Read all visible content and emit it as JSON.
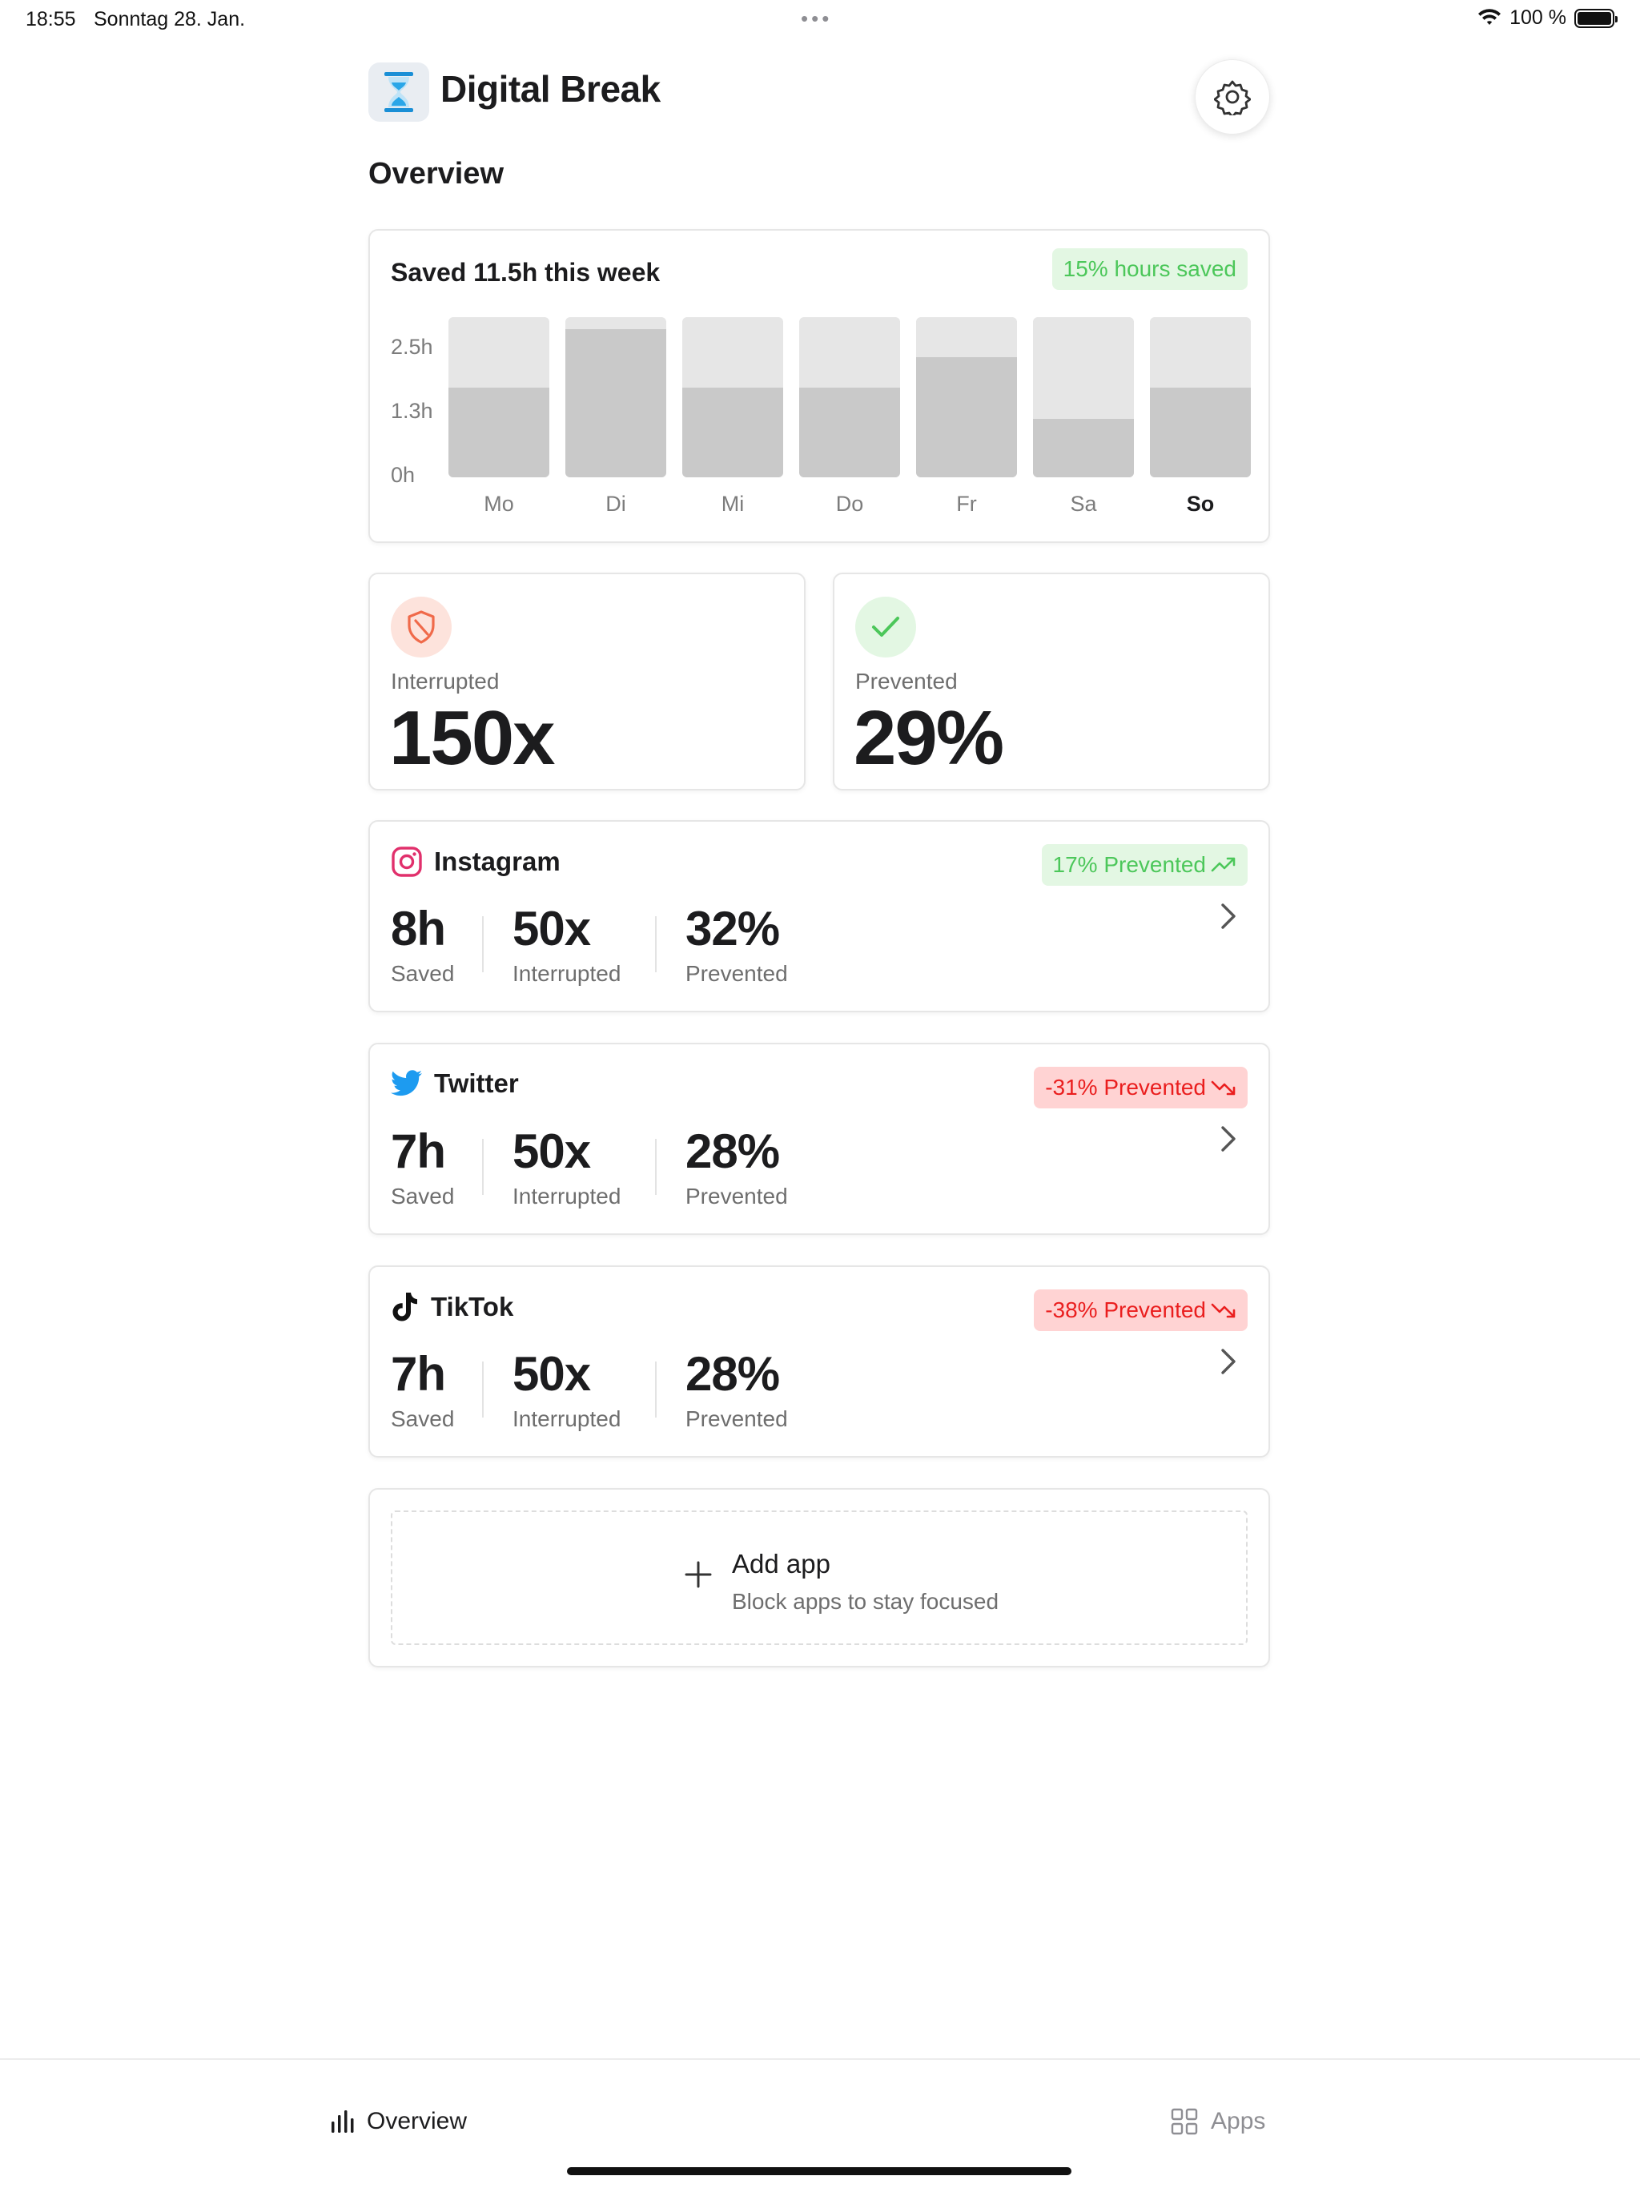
{
  "status_bar": {
    "time": "18:55",
    "date": "Sonntag 28. Jan.",
    "battery": "100 %"
  },
  "header": {
    "title": "Digital Break",
    "logo_icon": "hourglass-icon",
    "settings_icon": "gear-icon"
  },
  "overview": {
    "section_title": "Overview",
    "week": {
      "title": "Saved 11.5h this week",
      "badge": "15% hours saved",
      "y_ticks": [
        "2.5h",
        "1.3h",
        "0h"
      ],
      "active_day": "So"
    },
    "interrupted": {
      "label": "Interrupted",
      "value": "150x"
    },
    "prevented": {
      "label": "Prevented",
      "value": "29%"
    }
  },
  "chart_data": {
    "type": "bar",
    "title": "Saved 11.5h this week",
    "categories": [
      "Mo",
      "Di",
      "Mi",
      "Do",
      "Fr",
      "Sa",
      "So"
    ],
    "values": [
      1.45,
      2.4,
      1.45,
      1.45,
      1.95,
      0.95,
      1.45
    ],
    "ylim": [
      0,
      2.6
    ],
    "y_ticks": [
      "2.5h",
      "1.3h",
      "0h"
    ],
    "grid": false
  },
  "apps": [
    {
      "name": "Instagram",
      "icon": "instagram-icon",
      "trend_label": "17% Prevented",
      "trend": "up",
      "saved": "8h",
      "saved_label": "Saved",
      "interrupted": "50x",
      "interrupted_label": "Interrupted",
      "prevented": "32%",
      "prevented_label": "Prevented"
    },
    {
      "name": "Twitter",
      "icon": "twitter-icon",
      "trend_label": "-31% Prevented",
      "trend": "down",
      "saved": "7h",
      "saved_label": "Saved",
      "interrupted": "50x",
      "interrupted_label": "Interrupted",
      "prevented": "28%",
      "prevented_label": "Prevented"
    },
    {
      "name": "TikTok",
      "icon": "tiktok-icon",
      "trend_label": "-38% Prevented",
      "trend": "down",
      "saved": "7h",
      "saved_label": "Saved",
      "interrupted": "50x",
      "interrupted_label": "Interrupted",
      "prevented": "28%",
      "prevented_label": "Prevented"
    }
  ],
  "add_app": {
    "title": "Add app",
    "subtitle": "Block apps to stay focused"
  },
  "tab_bar": {
    "overview": "Overview",
    "apps": "Apps"
  },
  "colors": {
    "positive": "#4cc75a",
    "positive_bg": "#e3f7e3",
    "negative": "#ea1e1e",
    "negative_bg": "#ffd3d3",
    "shield_bg": "#fde3dc",
    "shield": "#f06a4a"
  }
}
